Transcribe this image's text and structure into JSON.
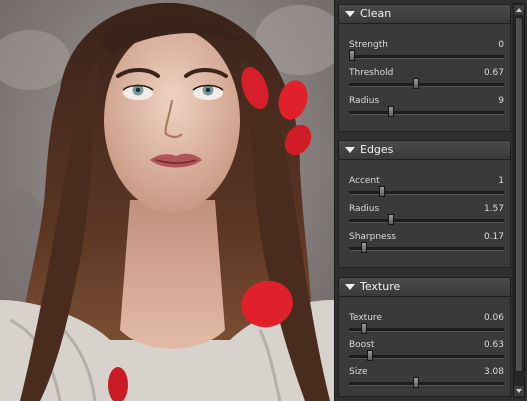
{
  "image": {
    "subject": "photo-canvas"
  },
  "sections": [
    {
      "title": "Clean",
      "params": [
        {
          "label": "Strength",
          "value": "0",
          "level": 0.0
        },
        {
          "label": "Threshold",
          "value": "0.67",
          "level": 0.43
        },
        {
          "label": "Radius",
          "value": "9",
          "level": 0.26
        }
      ]
    },
    {
      "title": "Edges",
      "params": [
        {
          "label": "Accent",
          "value": "1",
          "level": 0.2
        },
        {
          "label": "Radius",
          "value": "1.57",
          "level": 0.26
        },
        {
          "label": "Sharpness",
          "value": "0.17",
          "level": 0.08
        }
      ]
    },
    {
      "title": "Texture",
      "params": [
        {
          "label": "Texture",
          "value": "0.06",
          "level": 0.08
        },
        {
          "label": "Boost",
          "value": "0.63",
          "level": 0.12
        },
        {
          "label": "Size",
          "value": "3.08",
          "level": 0.43
        }
      ]
    }
  ],
  "colors": {
    "panel_bg": "#2f2f2f",
    "section_bg": "#3a3a3a",
    "petal_red": "#e0202a"
  },
  "icons": {
    "collapse": "triangle-down-icon",
    "scroll_up": "arrow-up-icon",
    "scroll_down": "arrow-down-icon"
  }
}
